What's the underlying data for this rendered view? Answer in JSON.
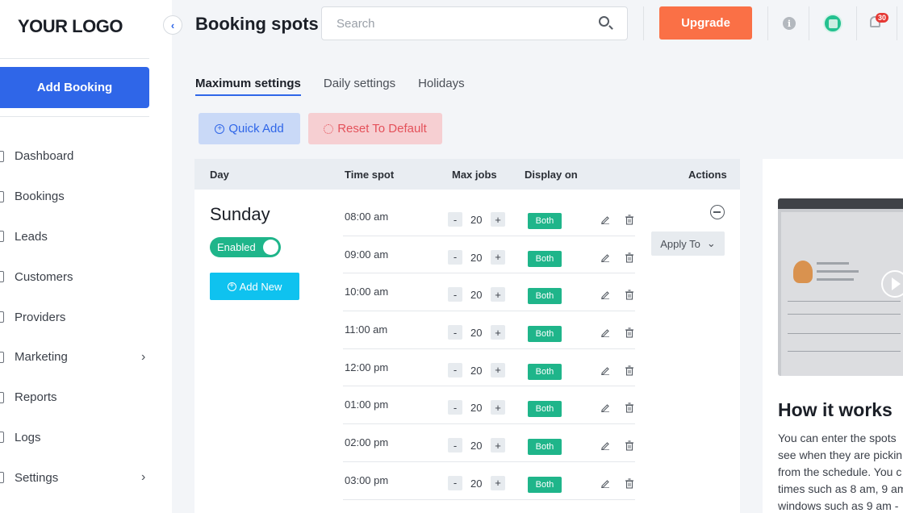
{
  "sidebar": {
    "logo": "YOUR LOGO",
    "add_booking": "Add Booking",
    "items": [
      {
        "label": "Dashboard",
        "chevron": false
      },
      {
        "label": "Bookings",
        "chevron": false
      },
      {
        "label": "Leads",
        "chevron": false
      },
      {
        "label": "Customers",
        "chevron": false
      },
      {
        "label": "Providers",
        "chevron": false
      },
      {
        "label": "Marketing",
        "chevron": true
      },
      {
        "label": "Reports",
        "chevron": false
      },
      {
        "label": "Logs",
        "chevron": false
      },
      {
        "label": "Settings",
        "chevron": true
      }
    ]
  },
  "header": {
    "title": "Booking spots",
    "search_placeholder": "Search",
    "upgrade": "Upgrade",
    "info_glyph": "i",
    "notification_count": "30",
    "icons": [
      "search-icon",
      "info-icon",
      "avatar",
      "bell-icon"
    ]
  },
  "tabs": [
    {
      "label": "Maximum settings",
      "active": true
    },
    {
      "label": "Daily settings",
      "active": false
    },
    {
      "label": "Holidays",
      "active": false
    }
  ],
  "actions": {
    "quick_add": "Quick Add",
    "reset": "Reset To Default"
  },
  "table": {
    "columns": {
      "day": "Day",
      "time_spot": "Time spot",
      "max_jobs": "Max jobs",
      "display_on": "Display on",
      "actions": "Actions"
    },
    "day": "Sunday",
    "toggle": "Enabled",
    "add_new": "Add New",
    "apply_to": "Apply To",
    "rows": [
      {
        "time": "08:00 am",
        "max": "20",
        "display": "Both"
      },
      {
        "time": "09:00 am",
        "max": "20",
        "display": "Both"
      },
      {
        "time": "10:00 am",
        "max": "20",
        "display": "Both"
      },
      {
        "time": "11:00 am",
        "max": "20",
        "display": "Both"
      },
      {
        "time": "12:00 pm",
        "max": "20",
        "display": "Both"
      },
      {
        "time": "01:00 pm",
        "max": "20",
        "display": "Both"
      },
      {
        "time": "02:00 pm",
        "max": "20",
        "display": "Both"
      },
      {
        "time": "03:00 pm",
        "max": "20",
        "display": "Both"
      }
    ]
  },
  "panel": {
    "title": "How it works",
    "lines": [
      "You can enter the spots",
      "see when they are pickin",
      "from the schedule. You c",
      "times such as 8 am, 9 am",
      "windows such as 9 am -"
    ]
  },
  "colors": {
    "primary": "#2f66e8",
    "upgrade": "#fa7046",
    "success": "#1fb58a",
    "add_new": "#0fc2ef",
    "reset_text": "#e4515a"
  }
}
